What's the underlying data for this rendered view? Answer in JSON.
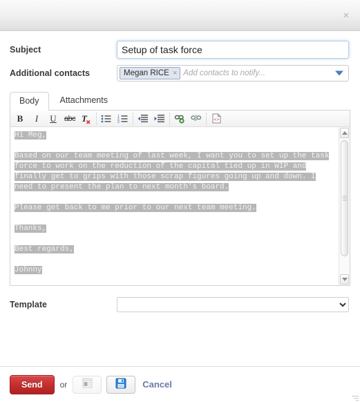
{
  "dialog": {
    "close_label": "×"
  },
  "form": {
    "subject": {
      "label": "Subject",
      "value": "Setup of task force"
    },
    "contacts": {
      "label": "Additional contacts",
      "tags": [
        {
          "name": "Megan RICE",
          "remove_label": "×"
        }
      ],
      "placeholder": "Add contacts to notify...",
      "dropdown_icon": "chevron-down-icon"
    }
  },
  "tabs": [
    {
      "label": "Body",
      "active": true
    },
    {
      "label": "Attachments",
      "active": false
    }
  ],
  "toolbar": {
    "buttons": [
      {
        "name": "bold-button",
        "glyph": "B",
        "title": "Bold"
      },
      {
        "name": "italic-button",
        "glyph": "I",
        "title": "Italic"
      },
      {
        "name": "underline-button",
        "glyph": "U",
        "title": "Underline"
      },
      {
        "name": "strikethrough-button",
        "glyph": "abc",
        "title": "Strikethrough"
      },
      {
        "name": "remove-format-button",
        "glyph": "T",
        "title": "Remove Format"
      },
      {
        "name": "bulleted-list-button",
        "glyph": "",
        "title": "Insert/Remove Bulleted List"
      },
      {
        "name": "numbered-list-button",
        "glyph": "",
        "title": "Insert/Remove Numbered List"
      },
      {
        "name": "outdent-button",
        "glyph": "",
        "title": "Decrease Indent"
      },
      {
        "name": "indent-button",
        "glyph": "",
        "title": "Increase Indent"
      },
      {
        "name": "link-button",
        "glyph": "",
        "title": "Link"
      },
      {
        "name": "unlink-button",
        "glyph": "",
        "title": "Unlink"
      },
      {
        "name": "source-button",
        "glyph": "<>",
        "title": "Source"
      }
    ]
  },
  "body": {
    "selected": true,
    "paragraphs": [
      "Hi Meg,",
      "Based on our team meeting of last week, I want you to set up the task force to work on the reduction of the capital tied up in WIP and finally get to grips with those scrap figures going up and down. I need to present the plan to next month's board.",
      "Please get back to me prior to our next team meeting.",
      "Thanks,",
      "Best regards,",
      "Johnny"
    ]
  },
  "template": {
    "label": "Template",
    "value": "",
    "options": [
      ""
    ]
  },
  "footer": {
    "send_label": "Send",
    "or_label": "or",
    "preview_icon": "preview-document-icon",
    "save_icon": "floppy-disk-save-icon",
    "cancel_label": "Cancel"
  },
  "colors": {
    "send_red": "#c42f2f",
    "cancel_link": "#6b7aa8",
    "selection_gray": "#b7b7b7",
    "tag_blue": "#dfe6ef",
    "focus_blue": "#b9cbe0"
  }
}
